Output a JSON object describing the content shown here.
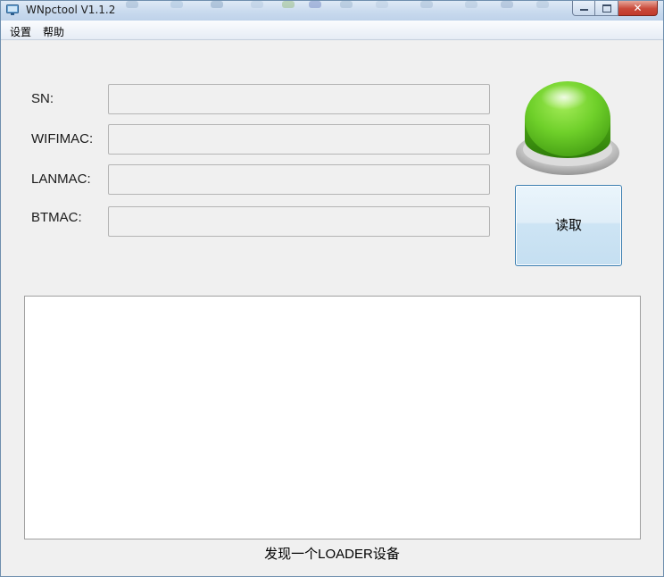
{
  "window": {
    "title": "WNpctool V1.1.2",
    "close_glyph": "✕",
    "icons": {
      "app": "app-icon",
      "minimize": "minimize-icon",
      "maximize": "maximize-icon",
      "close": "close-icon"
    }
  },
  "menu": {
    "items": [
      {
        "label": "设置"
      },
      {
        "label": "帮助"
      }
    ]
  },
  "fields": [
    {
      "label": "SN:",
      "value": ""
    },
    {
      "label": "WIFIMAC:",
      "value": ""
    },
    {
      "label": "LANMAC:",
      "value": ""
    },
    {
      "label": "BTMAC:",
      "value": ""
    }
  ],
  "status_light": {
    "icon": "green-status-light-icon",
    "color": "#5cc21e"
  },
  "read_button": {
    "label": "读取"
  },
  "log": {
    "content": ""
  },
  "status": {
    "text": "发现一个LOADER设备"
  },
  "colors": {
    "accent": "#3c7fb1",
    "window_bg": "#f0f0f0",
    "close_button": "#c9493a"
  }
}
